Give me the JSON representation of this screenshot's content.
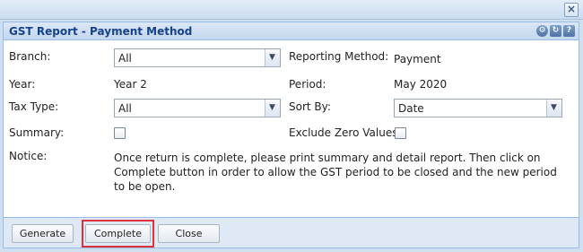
{
  "window": {
    "close_glyph": "×"
  },
  "panel": {
    "title": "GST Report - Payment Method",
    "tools": [
      "gear-icon",
      "refresh-icon",
      "help-icon"
    ]
  },
  "form": {
    "branch_label": "Branch:",
    "branch_value": "All",
    "reporting_method_label": "Reporting Method:",
    "reporting_method_value": "Payment",
    "year_label": "Year:",
    "year_value": "Year 2",
    "period_label": "Period:",
    "period_value": "May 2020",
    "tax_type_label": "Tax Type:",
    "tax_type_value": "All",
    "sort_by_label": "Sort By:",
    "sort_by_value": "Date",
    "summary_label": "Summary:",
    "summary_checked": false,
    "exclude_zero_label": "Exclude Zero Values:",
    "exclude_zero_checked": false,
    "notice_label": "Notice:",
    "notice_text": "Once return is complete, please print summary and detail report. Then click on Complete button in order to allow the GST period to be closed and the new period to be open."
  },
  "footer": {
    "generate_label": "Generate",
    "complete_label": "Complete",
    "close_label": "Close",
    "highlight_color": "#e0303a"
  }
}
